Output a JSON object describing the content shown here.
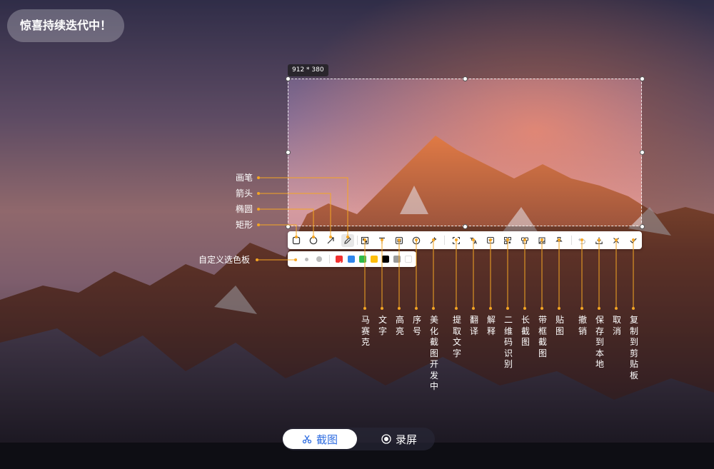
{
  "badge": {
    "text": "惊喜持续迭代中！"
  },
  "selection": {
    "size_text": "912 * 380"
  },
  "toolbar": {
    "tools": [
      {
        "name": "rect-tool",
        "icon": "square-icon"
      },
      {
        "name": "ellipse-tool",
        "icon": "circle-icon"
      },
      {
        "name": "arrow-tool",
        "icon": "arrow-icon"
      },
      {
        "name": "pen-tool",
        "icon": "pencil-icon",
        "active": true
      },
      {
        "name": "mosaic-tool",
        "icon": "mosaic-icon"
      },
      {
        "name": "text-tool",
        "icon": "text-icon"
      },
      {
        "name": "highlight-tool",
        "icon": "highlight-icon"
      },
      {
        "name": "number-tool",
        "icon": "number-icon"
      },
      {
        "name": "beautify-tool",
        "icon": "magic-icon"
      },
      {
        "name": "ocr-tool",
        "icon": "ocr-icon"
      },
      {
        "name": "translate-tool",
        "icon": "translate-icon"
      },
      {
        "name": "explain-tool",
        "icon": "explain-icon"
      },
      {
        "name": "qrcode-tool",
        "icon": "qrcode-icon"
      },
      {
        "name": "long-screenshot-tool",
        "icon": "long-capture-icon"
      },
      {
        "name": "framed-screenshot-tool",
        "icon": "frame-icon"
      },
      {
        "name": "pin-tool",
        "icon": "pin-icon"
      },
      {
        "name": "undo-tool",
        "icon": "undo-icon"
      },
      {
        "name": "save-tool",
        "icon": "download-icon"
      },
      {
        "name": "cancel-tool",
        "icon": "close-icon"
      },
      {
        "name": "copy-tool",
        "icon": "check-icon"
      }
    ]
  },
  "palette": {
    "colors": [
      "#f23030",
      "#2f86ec",
      "#2fba4b",
      "#ffbe0a",
      "#000000",
      "#9a9a9a",
      "#ffffff"
    ]
  },
  "labels_left": [
    "画笔",
    "箭头",
    "椭圆",
    "矩形",
    "自定义选色板"
  ],
  "labels_vertical": [
    "马赛克",
    "文字",
    "高亮",
    "序号",
    "美化截图开发中",
    "提取文字",
    "翻译",
    "解释",
    "二维码识别",
    "长截图",
    "带框截图",
    "贴图",
    "撤销",
    "保存到本地",
    "取消",
    "复制到剪贴板"
  ],
  "mode_switch": {
    "capture": "截图",
    "record": "录屏"
  },
  "colors": {
    "accent": "#f5a623",
    "primary": "#2f6de1"
  }
}
